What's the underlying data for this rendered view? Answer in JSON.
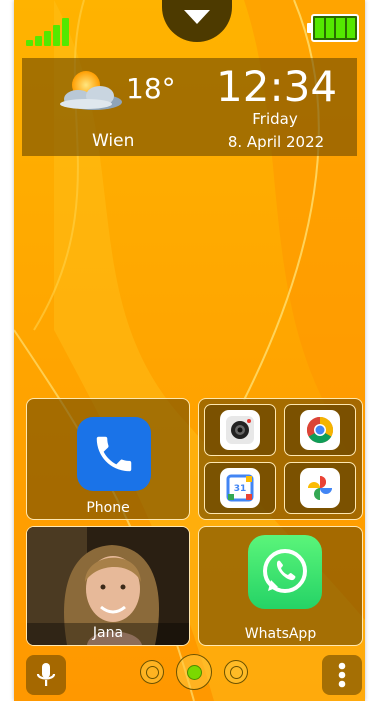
{
  "status": {
    "signal_bars": 5,
    "battery_level": 1.0
  },
  "weather": {
    "temperature": "18°",
    "city": "Wien",
    "icon": "partly-cloudy-icon"
  },
  "clock": {
    "time": "12:34",
    "day": "Friday",
    "date": "8. April 2022"
  },
  "tiles": {
    "phone": {
      "label": "Phone",
      "icon": "phone-icon"
    },
    "apps": [
      "camera-icon",
      "chrome-icon",
      "calendar-icon",
      "photos-icon"
    ],
    "calendar_day": "31",
    "contact": {
      "name": "Jana"
    },
    "whatsapp": {
      "label": "WhatsApp",
      "icon": "whatsapp-icon"
    }
  },
  "bottom_bar": {
    "mic": "microphone-icon",
    "menu": "more-vertical-icon",
    "pages": 3,
    "active_page": 2
  },
  "colors": {
    "background": "#ffa800",
    "panel": "#6e4b00",
    "signal": "#54e800",
    "phone_blue": "#1a73e8",
    "whatsapp_green": "#25d366"
  }
}
